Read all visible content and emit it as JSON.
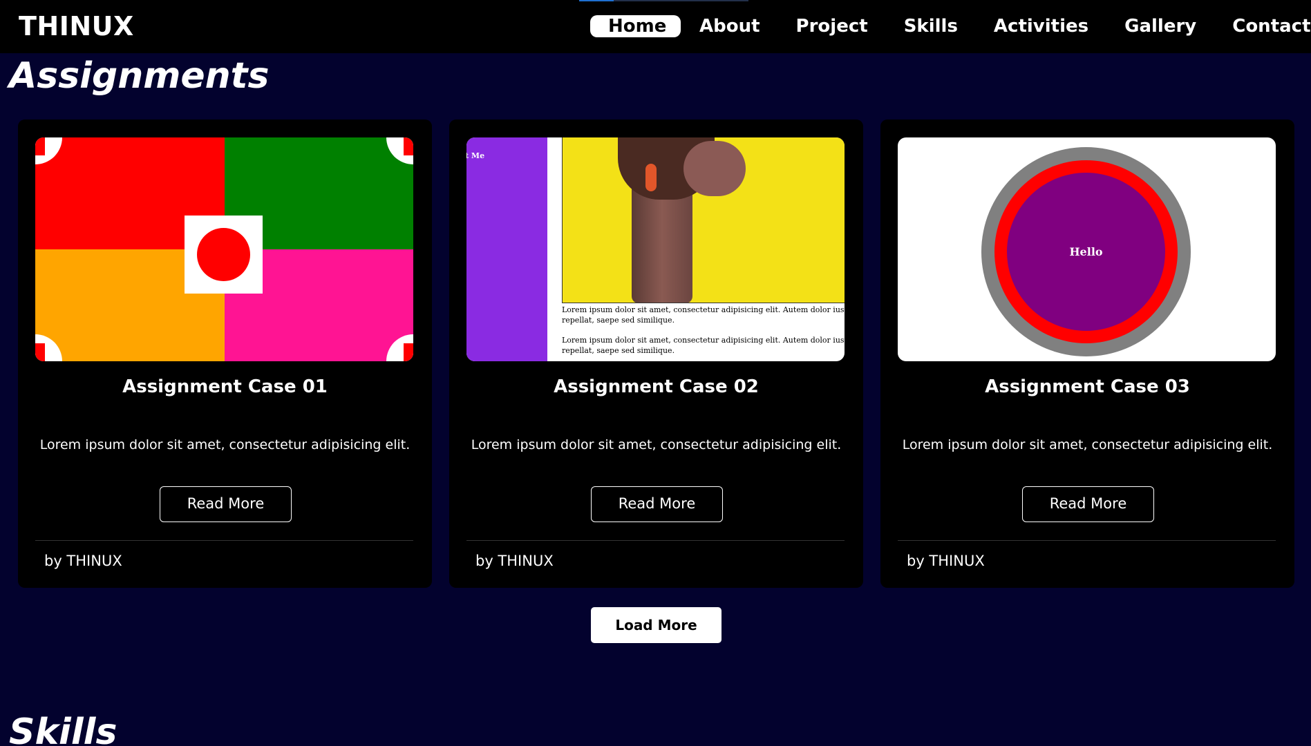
{
  "nav": {
    "logo": "THINUX",
    "items": [
      {
        "label": "Home",
        "active": true
      },
      {
        "label": "About"
      },
      {
        "label": "Project"
      },
      {
        "label": "Skills"
      },
      {
        "label": "Activities"
      },
      {
        "label": "Gallery"
      },
      {
        "label": "Contact"
      }
    ]
  },
  "sections": {
    "assignments_title": "Assignments",
    "skills_title": "Skills"
  },
  "cards": [
    {
      "title": "Assignment Case 01",
      "description": "Lorem ipsum dolor sit amet, consectetur adipisicing elit.",
      "button": "Read More",
      "author": "by THINUX",
      "thumb_colors": [
        "#ff0000",
        "#008000",
        "#ffa500",
        "#ff1493"
      ]
    },
    {
      "title": "Assignment Case 02",
      "description": "Lorem ipsum dolor sit amet, consectetur adipisicing elit.",
      "button": "Read More",
      "author": "by THINUX",
      "thumb_label": "t Me",
      "thumb_paragraphs": [
        "Lorem ipsum dolor sit amet, consectetur adipisicing elit. Autem dolor iusto m",
        "repellat, saepe sed similique.",
        "Lorem ipsum dolor sit amet, consectetur adipisicing elit. Autem dolor iusto m",
        "repellat, saepe sed similique."
      ]
    },
    {
      "title": "Assignment Case 03",
      "description": "Lorem ipsum dolor sit amet, consectetur adipisicing elit.",
      "button": "Read More",
      "author": "by THINUX",
      "thumb_label": "Hello"
    }
  ],
  "load_more": "Load More",
  "colors": {
    "page_bg": "#03022e",
    "card_bg": "#000000",
    "nav_bg": "#000000",
    "accent": "#1e6fd0"
  }
}
